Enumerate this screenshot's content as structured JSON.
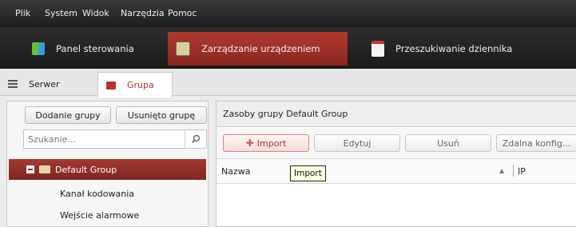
{
  "menubar": {
    "items": [
      "Plik",
      "System",
      "Widok",
      "Narzędzia",
      "Pomoc"
    ]
  },
  "main_tabs": [
    {
      "label": "Panel sterowania",
      "icon": "grid-icon",
      "active": false
    },
    {
      "label": "Zarządzanie urządzeniem",
      "icon": "toolbox-icon",
      "active": true
    },
    {
      "label": "Przeszukiwanie dziennika",
      "icon": "calendar-log-icon",
      "active": false
    }
  ],
  "sub_tabs": [
    {
      "label": "Serwer",
      "icon": "server-icon",
      "active": false
    },
    {
      "label": "Grupa",
      "icon": "folder-icon",
      "active": true
    }
  ],
  "left_panel": {
    "add_group_label": "Dodanie grupy",
    "delete_group_label": "Usunięto grupę",
    "search_placeholder": "Szukanie...",
    "tree": {
      "root_label": "Default Group",
      "children": [
        "Kanał kodowania",
        "Wejście alarmowe"
      ]
    }
  },
  "right_panel": {
    "header": "Zasoby grupy Default Group",
    "toolbar": {
      "import_label": "Import",
      "edit_label": "Edytuj",
      "delete_label": "Usuń",
      "remote_config_label": "Zdalna konfig..."
    },
    "columns": {
      "name": "Nazwa",
      "ip": "IP"
    },
    "tooltip": "Import"
  },
  "colors": {
    "accent_red": "#a8342c",
    "menubar_bg": "#2a2a2a"
  }
}
